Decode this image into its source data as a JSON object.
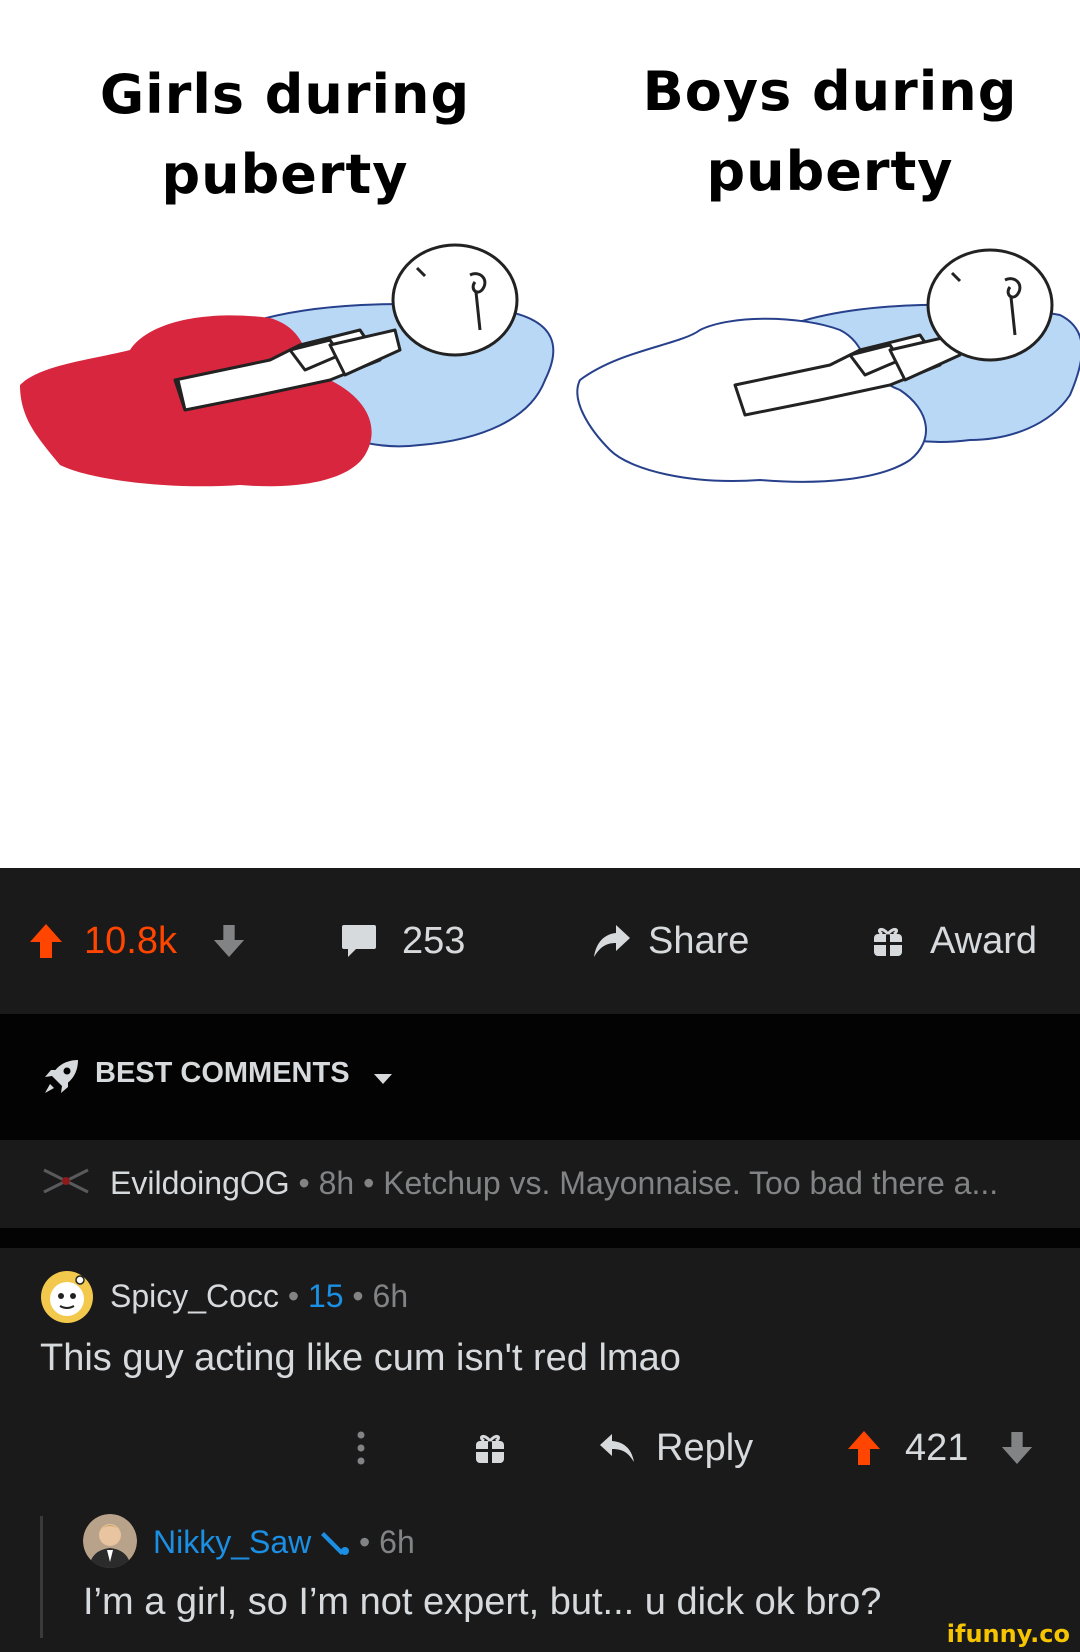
{
  "meme": {
    "caption_left": "Girls during puberty",
    "caption_right": "Boys during puberty",
    "left_puddle_color": "#d7263d",
    "right_puddle_color": "#ffffff",
    "water_color": "#b9d8f5"
  },
  "action_bar": {
    "score": "10.8k",
    "comments": "253",
    "share_label": "Share",
    "award_label": "Award",
    "icons": [
      "upvote-icon",
      "downvote-icon",
      "comment-bubble-icon",
      "share-arrow-icon",
      "gift-icon"
    ]
  },
  "sort": {
    "label": "BEST COMMENTS",
    "icon": "rocket-icon"
  },
  "pinned": {
    "username": "EvildoingOG",
    "time": "8h",
    "preview": "Ketchup vs. Mayonnaise. Too bad there a..."
  },
  "comment": {
    "username": "Spicy_Cocc",
    "karma": "15",
    "time": "6h",
    "body": "This guy acting like cum isn't red lmao",
    "reply_label": "Reply",
    "score": "421"
  },
  "reply": {
    "username": "Nikky_Saw",
    "time": "6h",
    "body": "I’m a girl, so I’m not expert, but... u dick ok bro?"
  },
  "watermark": "ifunny.co",
  "colors": {
    "upvote": "#ff4500",
    "link_blue": "#1a8fe3",
    "dark_bg": "#1a1a1b",
    "darker_bg": "#030303"
  }
}
